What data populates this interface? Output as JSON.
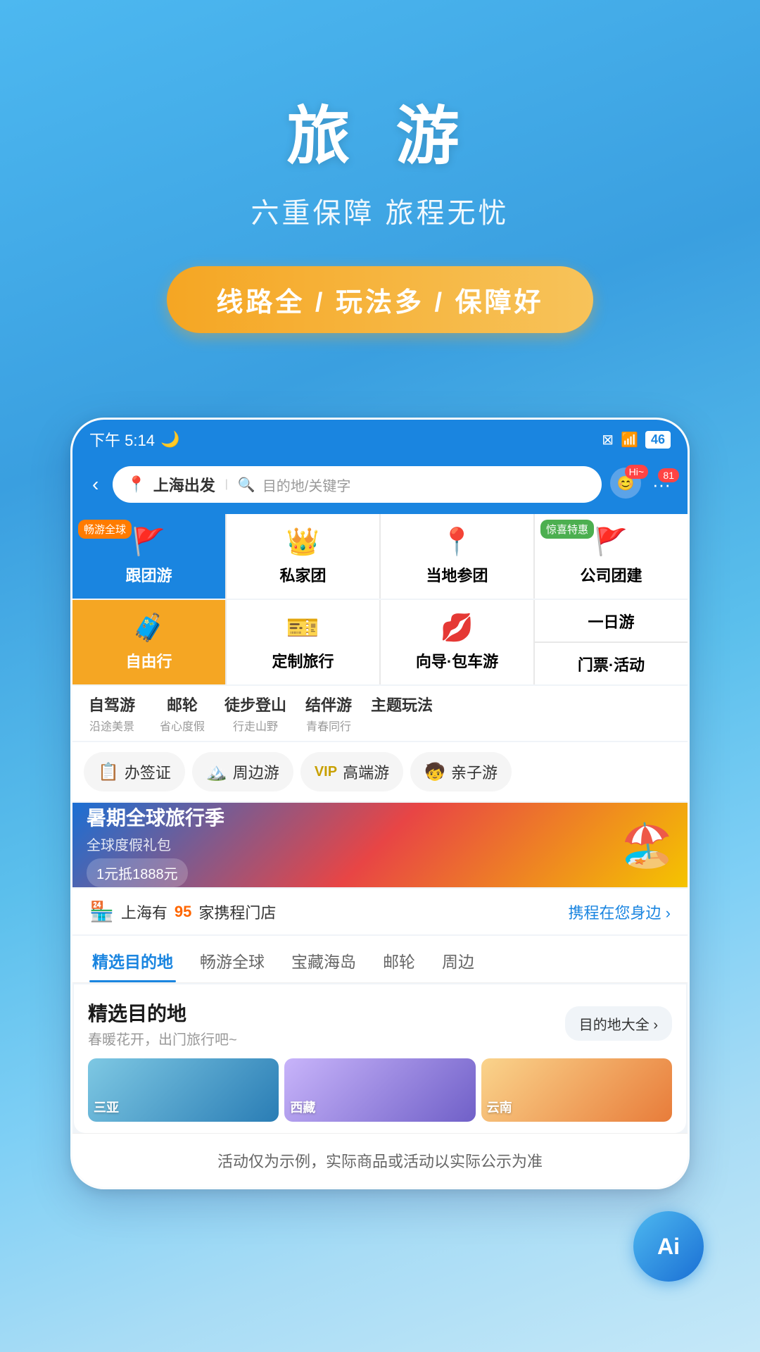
{
  "hero": {
    "title": "旅 游",
    "subtitle": "六重保障 旅程无忧",
    "badge": "线路全 / 玩法多 / 保障好"
  },
  "statusBar": {
    "time": "下午 5:14",
    "moonIcon": "🌙",
    "batteryIcon": "46",
    "wifiIcon": "wifi",
    "screenIcon": "screen"
  },
  "searchBar": {
    "backArrow": "‹",
    "locationPin": "📍",
    "fromCity": "上海出发",
    "searchIcon": "🔍",
    "placeholder": "目的地/关键字",
    "hiBadge": "Hi~",
    "moreBadge": "81"
  },
  "menuGrid": {
    "row1": [
      {
        "id": "group-tour",
        "label": "跟团游",
        "icon": "🚩",
        "bg": "blue",
        "badge": "畅游全球"
      },
      {
        "id": "private-tour",
        "label": "私家团",
        "icon": "👑",
        "bg": "white",
        "badge": ""
      },
      {
        "id": "local-tour",
        "label": "当地参团",
        "icon": "📍",
        "bg": "white",
        "badge": ""
      },
      {
        "id": "company-tour",
        "label": "公司团建",
        "icon": "🚩",
        "bg": "white",
        "badge": "惊喜特惠"
      }
    ],
    "row2": [
      {
        "id": "free-travel",
        "label": "自由行",
        "icon": "🧳",
        "bg": "orange",
        "badge": ""
      },
      {
        "id": "custom-travel",
        "label": "定制旅行",
        "icon": "🎫",
        "bg": "white",
        "badge": ""
      },
      {
        "id": "guide-bus",
        "label": "向导·包车游",
        "icon": "💋",
        "bg": "white",
        "badge": ""
      },
      {
        "id": "right-col",
        "label": "",
        "bg": "split",
        "topLabel": "一日游",
        "bottomLabel": "门票·活动",
        "badge": ""
      }
    ]
  },
  "thirdRow": [
    {
      "main": "自驾游",
      "sub": "沿途美景"
    },
    {
      "main": "邮轮",
      "sub": "省心度假"
    },
    {
      "main": "徒步登山",
      "sub": "行走山野"
    },
    {
      "main": "结伴游",
      "sub": "青春同行"
    },
    {
      "main": "主题玩法",
      "sub": ""
    }
  ],
  "fourthRow": [
    {
      "label": "办签证",
      "icon": "📋"
    },
    {
      "label": "周边游",
      "icon": "🏔️"
    },
    {
      "label": "高端游",
      "icon": "VIP",
      "isVip": true
    },
    {
      "label": "亲子游",
      "icon": "🧒"
    }
  ],
  "banner": {
    "tag1": "暑期全球旅行季",
    "tag2": "全球度假礼包",
    "coupon": "1元抵1888元"
  },
  "storeRow": {
    "icon": "🏪",
    "prefix": "上海有",
    "count": "95",
    "suffix": "家携程门店",
    "link": "携程在您身边 ›"
  },
  "tabs": [
    {
      "label": "精选目的地",
      "active": true
    },
    {
      "label": "畅游全球",
      "active": false
    },
    {
      "label": "宝藏海岛",
      "active": false
    },
    {
      "label": "邮轮",
      "active": false
    },
    {
      "label": "周边",
      "active": false
    }
  ],
  "destCard": {
    "title": "精选目的地",
    "subtitle": "春暖花开，出门旅行吧~",
    "allBtn": "目的地大全 ›",
    "images": [
      {
        "label": "三亚"
      },
      {
        "label": "西藏"
      },
      {
        "label": "云南"
      }
    ]
  },
  "disclaimer": "活动仅为示例，实际商品或活动以实际公示为准",
  "aiBtn": "Ai"
}
